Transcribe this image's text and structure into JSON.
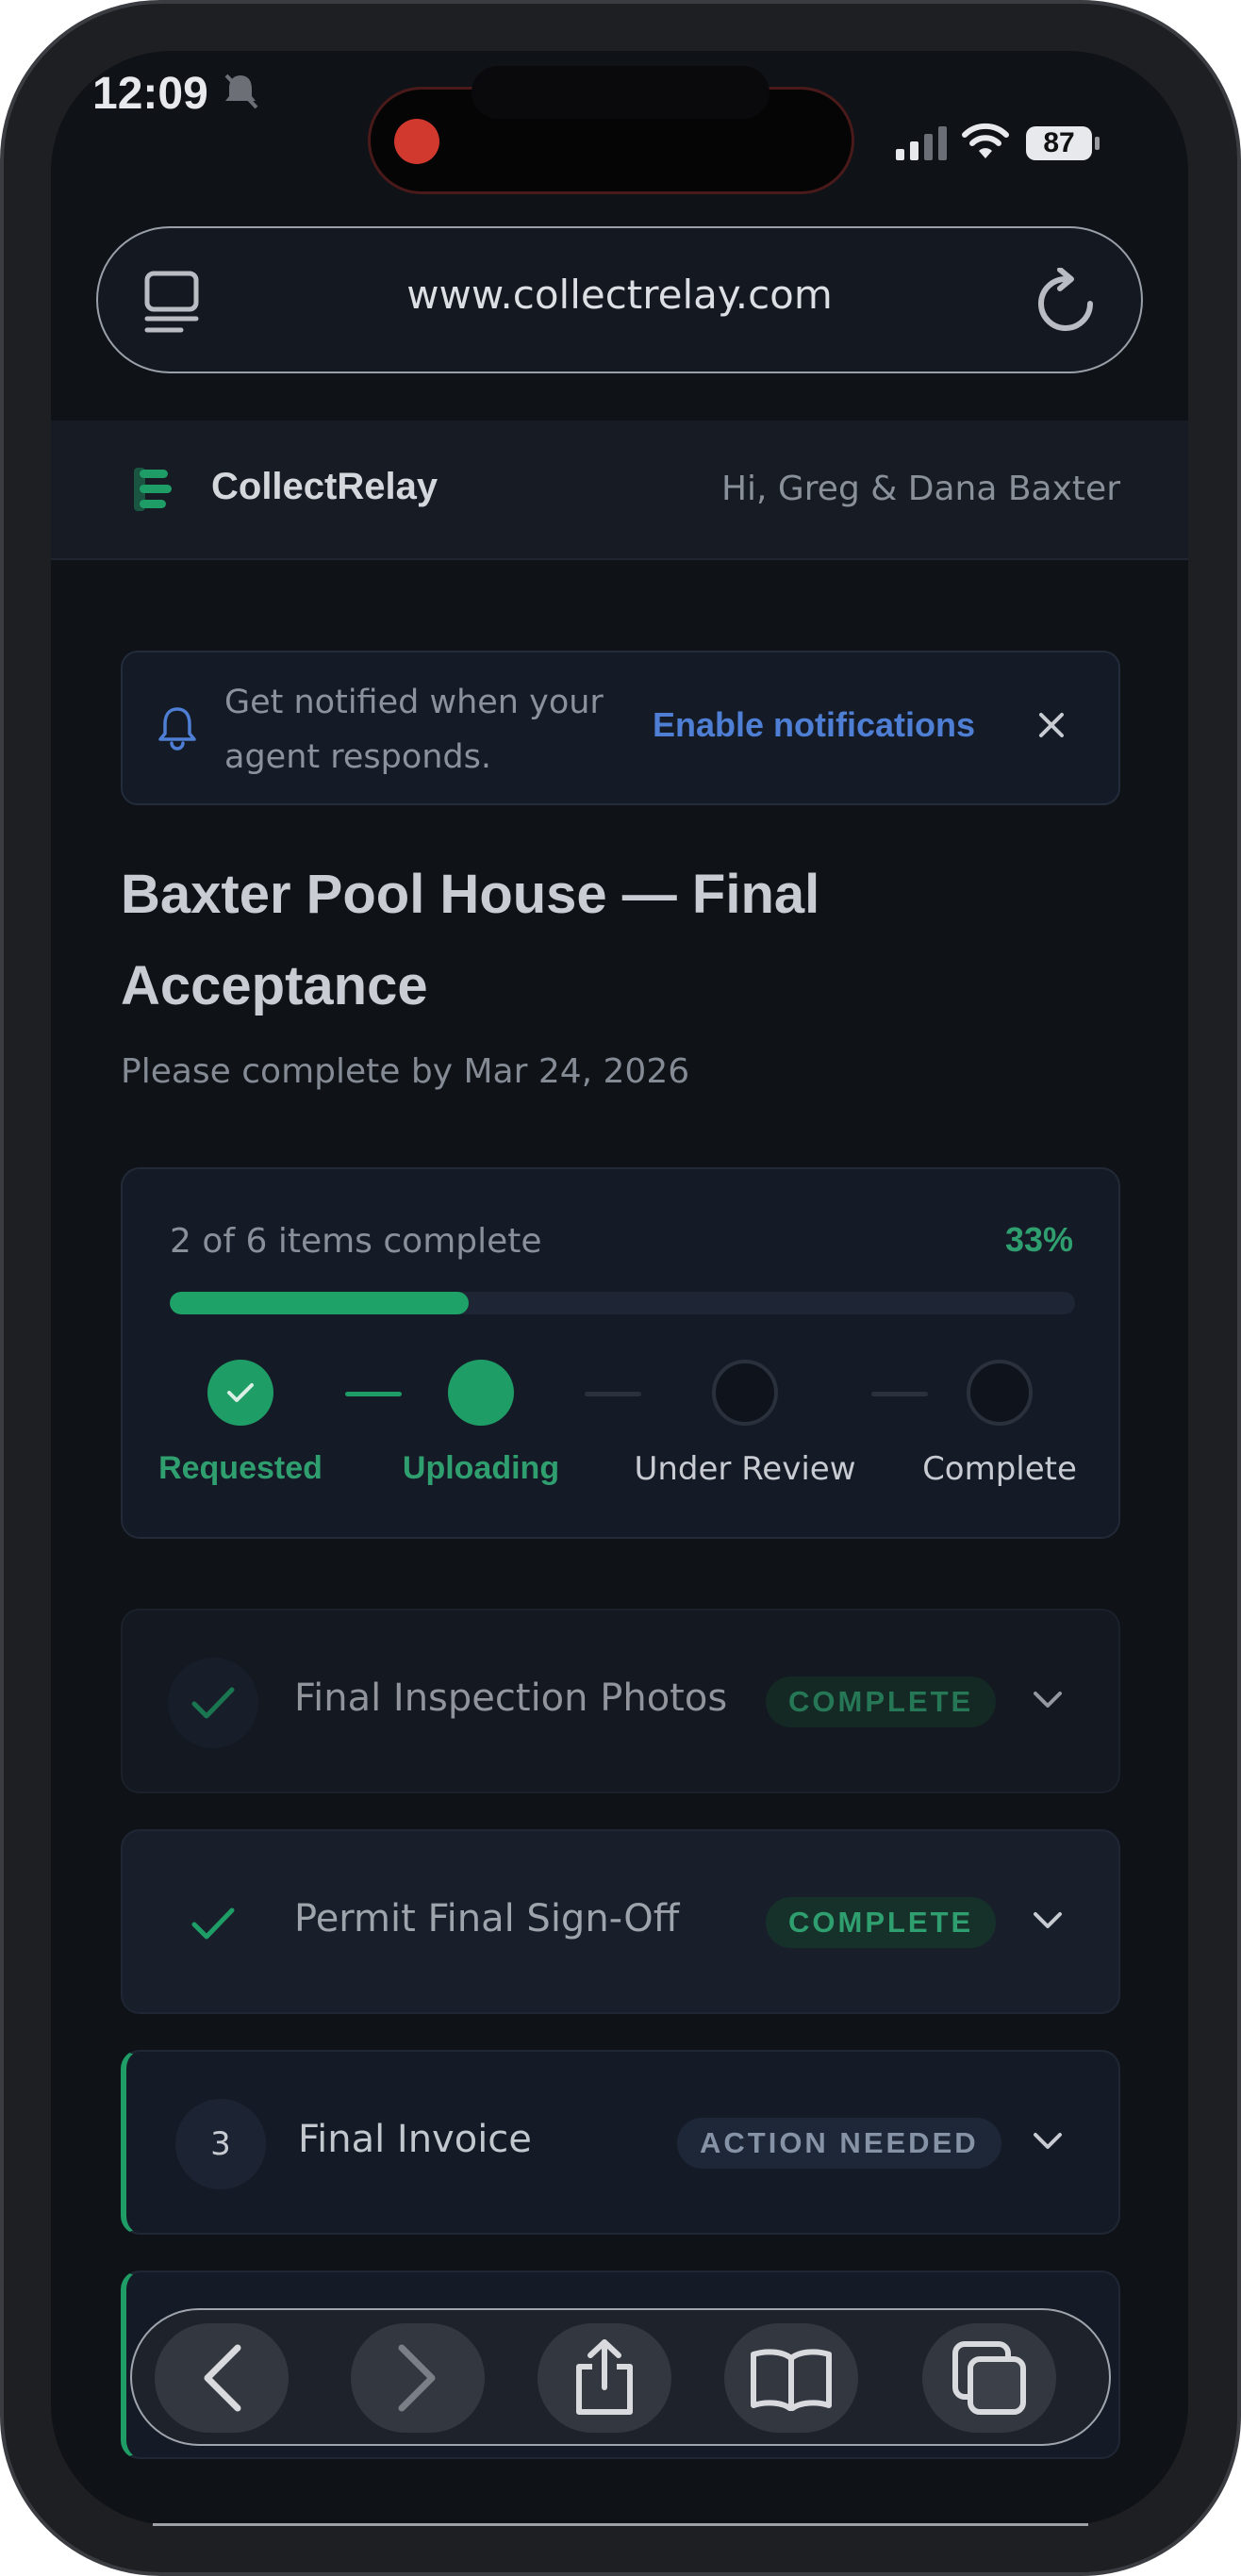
{
  "status_bar": {
    "time": "12:09",
    "battery": "87"
  },
  "browser": {
    "url": "www.collectrelay.com"
  },
  "header": {
    "app_name": "CollectRelay",
    "greeting": "Hi, Greg & Dana Baxter"
  },
  "notification": {
    "text": "Get notified when your agent responds.",
    "action_label": "Enable notifications"
  },
  "page": {
    "title": "Baxter Pool House — Final Acceptance",
    "due": "Please complete by Mar 24, 2026"
  },
  "progress": {
    "summary": "2 of 6 items complete",
    "percent_label": "33%",
    "fraction": 0.33,
    "steps": [
      {
        "label": "Requested",
        "state": "done"
      },
      {
        "label": "Uploading",
        "state": "active"
      },
      {
        "label": "Under Review",
        "state": "todo"
      },
      {
        "label": "Complete",
        "state": "todo"
      }
    ]
  },
  "items": [
    {
      "title": "Final Inspection Photos",
      "badge": "COMPLETE",
      "status": "complete"
    },
    {
      "title": "Permit Final Sign-Off",
      "badge": "COMPLETE",
      "status": "complete"
    },
    {
      "number": "3",
      "title": "Final Invoice",
      "badge": "ACTION NEEDED",
      "status": "action"
    }
  ],
  "colors": {
    "accent_green": "#1f9d66",
    "link_blue": "#4f7fd4",
    "background": "#0f1217"
  },
  "toolbar": {
    "icons": [
      "back-icon",
      "forward-icon",
      "share-icon",
      "bookmarks-icon",
      "tabs-overview-icon"
    ]
  }
}
